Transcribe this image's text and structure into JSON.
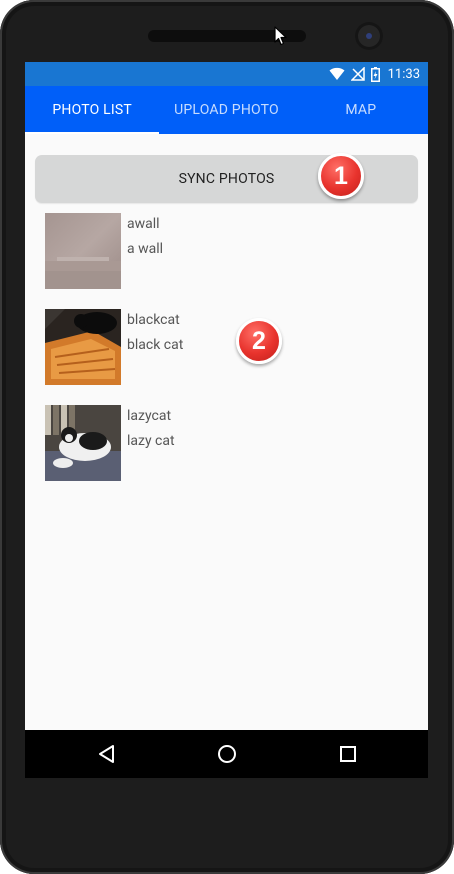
{
  "status_bar": {
    "time": "11:33",
    "color": "#1976d2",
    "icons": [
      "wifi-icon",
      "no-signal-icon",
      "battery-icon"
    ]
  },
  "tabs": [
    {
      "label": "PHOTO LIST",
      "active": true
    },
    {
      "label": "UPLOAD PHOTO",
      "active": false
    },
    {
      "label": "MAP",
      "active": false
    }
  ],
  "tab_bar_color": "#005ff9",
  "sync_button": {
    "label": "SYNC PHOTOS"
  },
  "photos": [
    {
      "title": "awall",
      "subtitle": "a wall",
      "thumb": "wall-photo"
    },
    {
      "title": "blackcat",
      "subtitle": "black cat",
      "thumb": "black-cat-photo"
    },
    {
      "title": "lazycat",
      "subtitle": "lazy cat",
      "thumb": "lazy-cat-photo"
    }
  ],
  "badges": [
    {
      "number": "1"
    },
    {
      "number": "2"
    }
  ],
  "nav": [
    "back-icon",
    "home-icon",
    "recent-apps-icon"
  ]
}
